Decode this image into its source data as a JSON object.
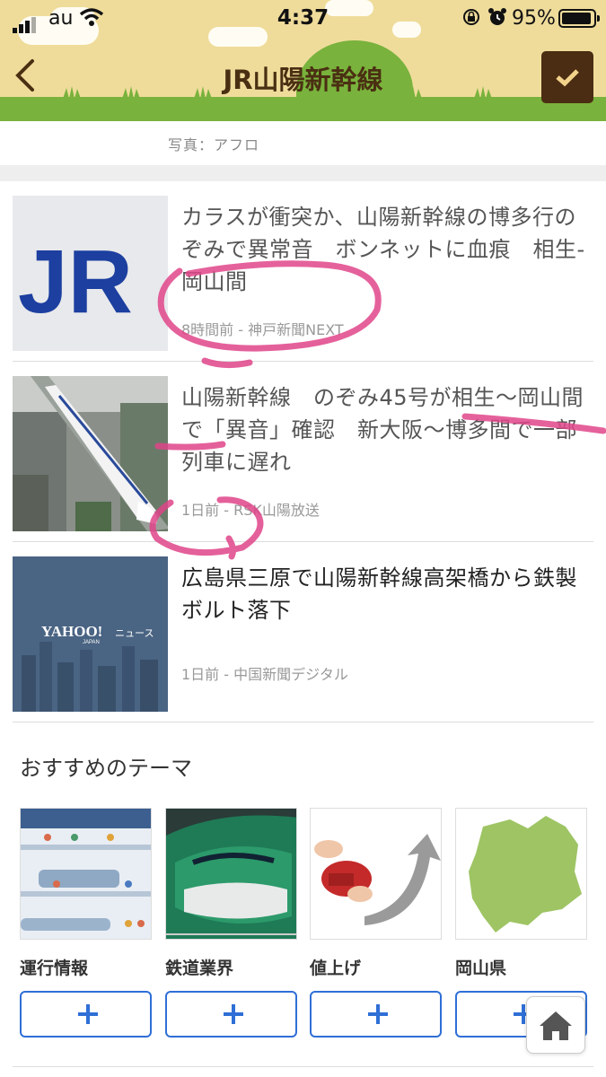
{
  "status_bar": {
    "carrier": "au",
    "time": "4:37",
    "battery": "95%"
  },
  "header": {
    "title": "JR山陽新幹線",
    "back_icon": "chevron-left-icon",
    "check_icon": "check-icon"
  },
  "photo_credit": "写真：アフロ",
  "news": [
    {
      "headline": "カラスが衝突か、山陽新幹線の博多行のぞみで異常音　ボンネットに血痕　相生-岡山間",
      "time": "8時間前",
      "source": "神戸新聞NEXT"
    },
    {
      "headline": "山陽新幹線　のぞみ45号が相生〜岡山間で「異音」確認　新大阪〜博多間で一部列車に遅れ",
      "time": "1日前",
      "source": "RSK山陽放送"
    },
    {
      "headline": "広島県三原で山陽新幹線高架橋から鉄製ボルト落下",
      "time": "1日前",
      "source": "中国新聞デジタル"
    }
  ],
  "thumbs": {
    "jr_logo": "JR",
    "yahoo_logo": "YAHOO!",
    "yahoo_news": "ニュース",
    "yahoo_japan": "JAPAN"
  },
  "themes_section": {
    "title": "おすすめのテーマ",
    "items": [
      {
        "name": "運行情報"
      },
      {
        "name": "鉄道業界"
      },
      {
        "name": "値上げ"
      },
      {
        "name": "岡山県"
      }
    ]
  },
  "colors": {
    "header_bg": "#efdc9b",
    "grass": "#79b23c",
    "title": "#4a2f12",
    "accent_blue": "#2f6fd6",
    "check_button": "#4a2d12"
  }
}
